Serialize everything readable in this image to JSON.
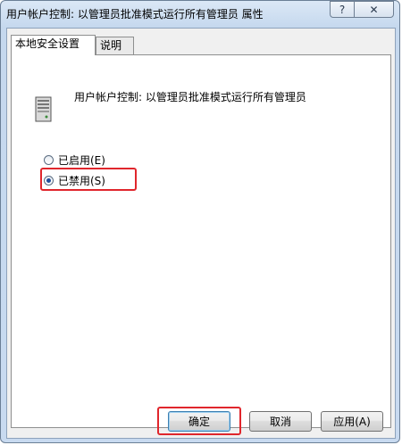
{
  "window": {
    "title": "用户帐户控制: 以管理员批准模式运行所有管理员 属性",
    "help_button": "?",
    "close_button": "✕"
  },
  "tabs": [
    {
      "label": "本地安全设置",
      "active": true
    },
    {
      "label": "说明",
      "active": false
    }
  ],
  "policy": {
    "name": "用户帐户控制: 以管理员批准模式运行所有管理员",
    "icon": "policy-computer-icon"
  },
  "options": [
    {
      "label": "已启用(E)",
      "checked": false
    },
    {
      "label": "已禁用(S)",
      "checked": true
    }
  ],
  "buttons": {
    "ok": "确定",
    "cancel": "取消",
    "apply": "应用(A)"
  },
  "colors": {
    "highlight": "#e0262c",
    "titlebar": "#c5d8ee"
  }
}
